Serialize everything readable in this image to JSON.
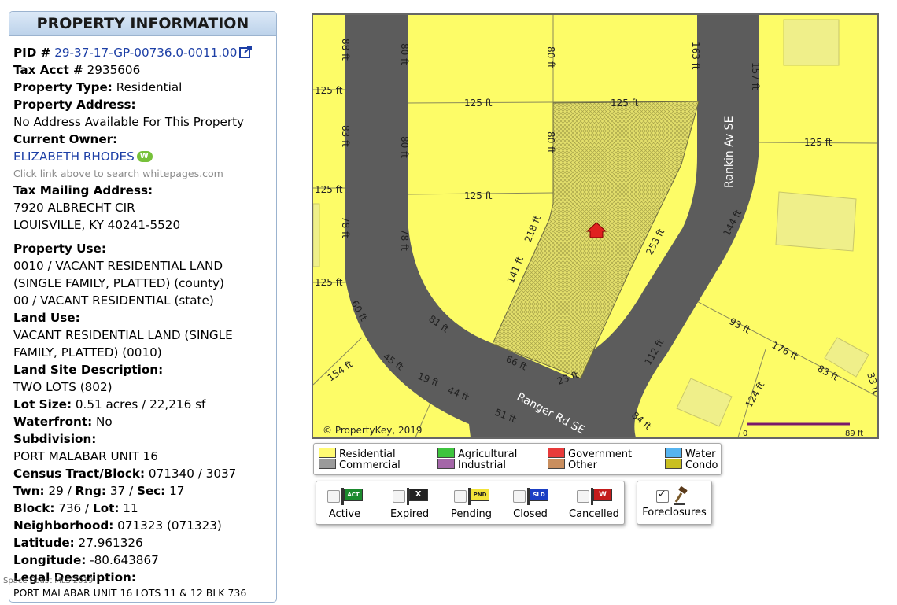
{
  "panel": {
    "title": "PROPERTY INFORMATION",
    "pid_label": "PID #",
    "pid_value": "29-37-17-GP-00736.0-0011.00",
    "tax_acct_label": "Tax Acct #",
    "tax_acct_value": "2935606",
    "property_type_label": "Property Type:",
    "property_type_value": "Residential",
    "property_address_label": "Property Address:",
    "property_address_value": "No Address Available For This Property",
    "current_owner_label": "Current Owner:",
    "owner_name": "ELIZABETH RHODES",
    "whitepages_hint": "Click link above to search whitepages.com",
    "tax_mailing_label": "Tax Mailing Address:",
    "mailing_line1": "7920 ALBRECHT CIR",
    "mailing_line2": "LOUISVILLE, KY 40241-5520",
    "property_use_label": "Property Use:",
    "property_use_line1": "0010 / VACANT RESIDENTIAL LAND",
    "property_use_line2": "(SINGLE FAMILY, PLATTED) (county)",
    "property_use_line3": "00 / VACANT RESIDENTIAL (state)",
    "land_use_label": "Land Use:",
    "land_use_line1": "VACANT RESIDENTIAL LAND (SINGLE",
    "land_use_line2": "FAMILY, PLATTED) (0010)",
    "land_site_label": "Land Site Description:",
    "land_site_value": "TWO LOTS (802)",
    "lot_size_label": "Lot Size:",
    "lot_size_value": "0.51 acres / 22,216 sf",
    "waterfront_label": "Waterfront:",
    "waterfront_value": "No",
    "subdivision_label": "Subdivision:",
    "subdivision_value": "PORT MALABAR UNIT 16",
    "census_label": "Census Tract/Block:",
    "census_value": "071340 / 3037",
    "twn_label": "Twn:",
    "twn_value": "29",
    "rng_label": "Rng:",
    "rng_value": "37",
    "sec_label": "Sec:",
    "sec_value": "17",
    "block_label": "Block:",
    "block_value": "736",
    "lot_label": "Lot:",
    "lot_value": "11",
    "neighborhood_label": "Neighborhood:",
    "neighborhood_value": "071323 (071323)",
    "latitude_label": "Latitude:",
    "latitude_value": "27.961326",
    "longitude_label": "Longitude:",
    "longitude_value": "-80.643867",
    "legal_label": "Legal Description:",
    "legal_value": "PORT MALABAR UNIT 16 LOTS 11 & 12 BLK 736",
    "watermark": "Space Coast MLS 2019"
  },
  "map": {
    "copyright": "© PropertyKey, 2019",
    "scale_zero": "0",
    "scale_end": "89 ft",
    "street_rankin": "Rankin Av SE",
    "street_ranger": "Ranger Rd SE",
    "dims": [
      "88 ft",
      "80 ft",
      "80 ft",
      "163 ft",
      "157 ft",
      "125 ft",
      "125 ft",
      "125 ft",
      "125 ft",
      "83 ft",
      "80 ft",
      "80 ft",
      "125 ft",
      "125 ft",
      "78 ft",
      "78 ft",
      "141 ft",
      "218 ft",
      "253 ft",
      "144 ft",
      "125 ft",
      "60 ft",
      "81 ft",
      "66 ft",
      "23 ft",
      "112 ft",
      "93 ft",
      "176 ft",
      "83 ft",
      "33 ft",
      "154 ft",
      "45 ft",
      "19 ft",
      "44 ft",
      "51 ft",
      "84 ft",
      "124 ft"
    ],
    "colors": {
      "residential": "#fdfc67",
      "road": "#5c5c5c",
      "hatch": "#d7d36a",
      "marker": "#e02020"
    }
  },
  "legend": {
    "residential": "Residential",
    "commercial": "Commercial",
    "agricultural": "Agricultural",
    "industrial": "Industrial",
    "government": "Government",
    "other": "Other",
    "water": "Water",
    "condo": "Condo",
    "colors": {
      "residential": "#fffa73",
      "commercial": "#9a9a9a",
      "agricultural": "#3ec43e",
      "industrial": "#a466a8",
      "government": "#e83a3a",
      "other": "#c98e5e",
      "water": "#56b4f0",
      "condo": "#c9bf20"
    }
  },
  "status": {
    "active": "Active",
    "active_badge": "ACT",
    "expired": "Expired",
    "expired_badge": "X",
    "pending": "Pending",
    "pending_badge": "PND",
    "closed": "Closed",
    "closed_badge": "SLD",
    "cancelled": "Cancelled",
    "cancelled_badge": "W",
    "foreclosures": "Foreclosures"
  }
}
